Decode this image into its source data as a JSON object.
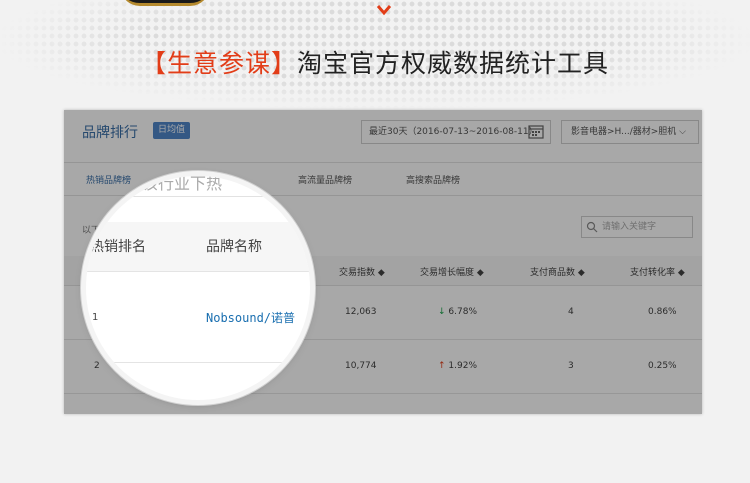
{
  "headline": {
    "bracket_text": "【生意参谋】",
    "main_text": "淘宝官方权威数据统计工具"
  },
  "panel": {
    "title": "品牌排行",
    "badge": "日均值",
    "date_range": "最近30天（2016-07-13~2016-08-11）",
    "category": "影音电器>H.../器材>胆机",
    "tabs": [
      {
        "label": "热销品牌榜",
        "active": true
      },
      {
        "label": "高流量品牌榜",
        "active": false
      },
      {
        "label": "高搜索品牌榜",
        "active": false
      }
    ],
    "note": "以下",
    "search_placeholder": "请输入关键字",
    "columns": [
      "交易指数 ◆",
      "交易增长幅度 ◆",
      "支付商品数 ◆",
      "支付转化率 ◆"
    ],
    "rows": [
      {
        "rank": "1",
        "trade_index": "12,063",
        "growth_arrow": "↓",
        "growth": "6.78%",
        "items": "4",
        "conversion": "0.86%"
      },
      {
        "rank": "2",
        "trade_index": "10,774",
        "growth_arrow": "↑",
        "growth": "1.92%",
        "items": "3",
        "conversion": "0.25%"
      }
    ]
  },
  "lens": {
    "tab_fragment": "看该行业下热",
    "col_rank": "热销排名",
    "col_brand": "品牌名称",
    "rank_value": "1",
    "brand_value": "Nobsound/诺普"
  },
  "colors": {
    "accent_red": "#e23d18",
    "link_blue": "#3a6fa8",
    "down_green": "#1aa34a"
  }
}
